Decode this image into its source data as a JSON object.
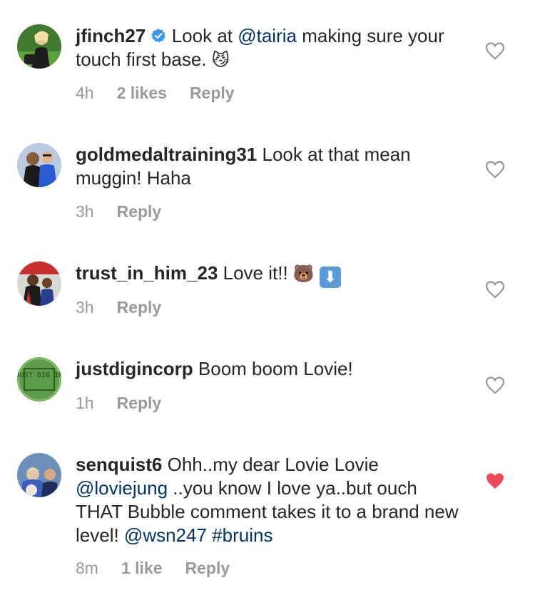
{
  "comments": [
    {
      "username": "jfinch27",
      "verified": true,
      "text_parts": [
        "Look at ",
        "@tairia",
        " making sure your touch first base. "
      ],
      "emoji": "😼",
      "time": "4h",
      "likes": "2 likes",
      "reply": "Reply",
      "liked": false
    },
    {
      "username": "goldmedaltraining31",
      "text": "Look at that mean muggin!  Haha",
      "time": "3h",
      "reply": "Reply",
      "liked": false
    },
    {
      "username": "trust_in_him_23",
      "text": "Love it!! ",
      "emoji": "🐻",
      "emoji2": "⬇",
      "time": "3h",
      "reply": "Reply",
      "liked": false
    },
    {
      "username": "justdigincorp",
      "avatar_text": "JUST DIG IN",
      "text": "Boom boom Lovie!",
      "time": "1h",
      "reply": "Reply",
      "liked": false
    },
    {
      "username": "senquist6",
      "text_parts": [
        "Ohh..my dear Lovie Lovie ",
        "@loviejung",
        " ..you know I love ya..but ouch THAT Bubble comment takes it to a brand new level! ",
        "@wsn247",
        " ",
        "#bruins"
      ],
      "time": "8m",
      "likes": "1 like",
      "reply": "Reply",
      "liked": true
    }
  ],
  "colors": {
    "text": "#262626",
    "meta": "#999999",
    "mention": "#003569",
    "verified": "#3897f0",
    "liked_heart": "#ed4956"
  }
}
